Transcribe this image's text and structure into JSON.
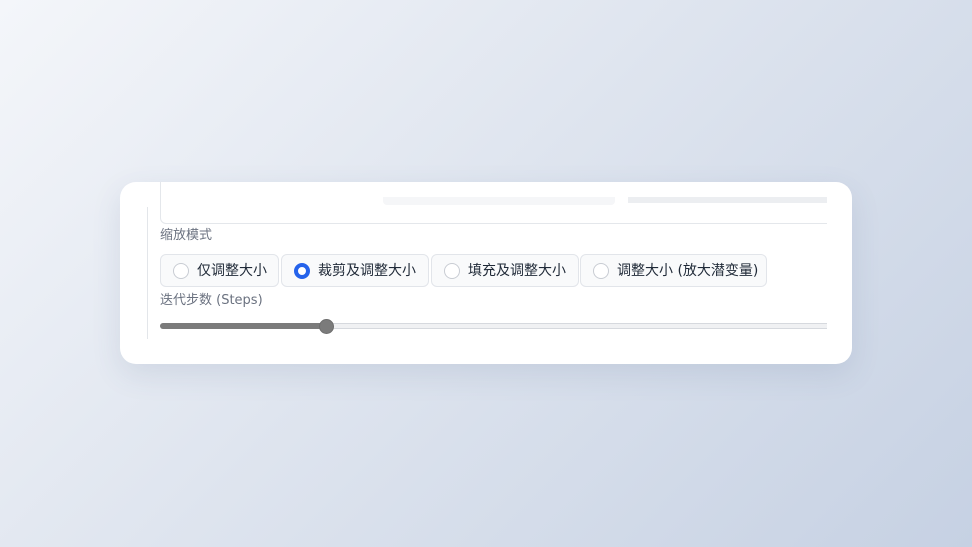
{
  "resize_mode": {
    "label": "缩放模式",
    "options": [
      {
        "label": "仅调整大小",
        "checked": false
      },
      {
        "label": "裁剪及调整大小",
        "checked": true
      },
      {
        "label": "填充及调整大小",
        "checked": false
      },
      {
        "label": "调整大小 (放大潜变量)",
        "checked": false
      }
    ],
    "selected": "裁剪及调整大小"
  },
  "steps": {
    "label": "迭代步数 (Steps)",
    "fill_fraction": 0.238
  },
  "colors": {
    "accent": "#2563eb",
    "slider": "#7b7b7b"
  }
}
